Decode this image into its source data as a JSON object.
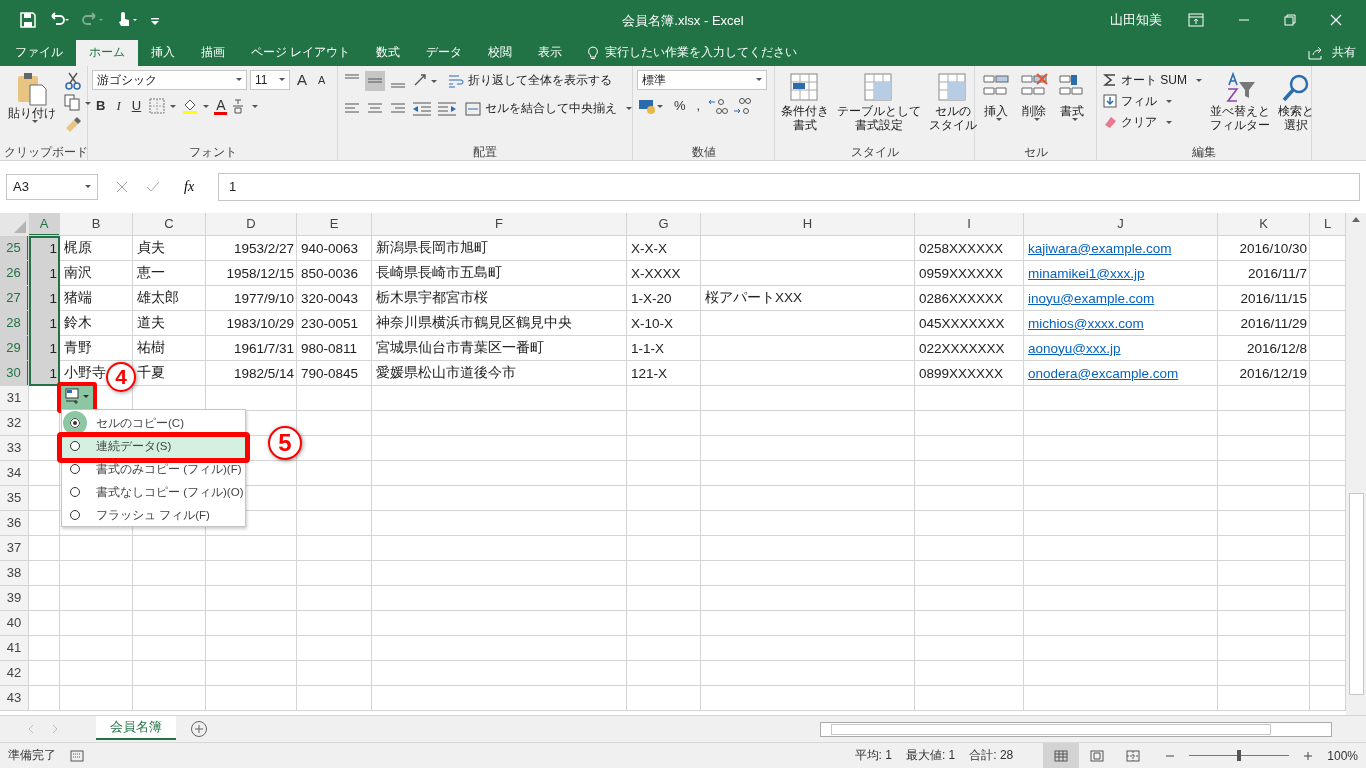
{
  "title_bar": {
    "title": "会員名簿.xlsx  -  Excel",
    "user": "山田知美"
  },
  "menu_tabs": [
    {
      "label": "ファイル",
      "selected": false
    },
    {
      "label": "ホーム",
      "selected": true
    },
    {
      "label": "挿入",
      "selected": false
    },
    {
      "label": "描画",
      "selected": false
    },
    {
      "label": "ページ レイアウト",
      "selected": false
    },
    {
      "label": "数式",
      "selected": false
    },
    {
      "label": "データ",
      "selected": false
    },
    {
      "label": "校閲",
      "selected": false
    },
    {
      "label": "表示",
      "selected": false
    }
  ],
  "tell_me": "実行したい作業を入力してください",
  "share": "共有",
  "ribbon": {
    "clipboard": {
      "paste": "貼り付け",
      "label": "クリップボード"
    },
    "font": {
      "name": "游ゴシック",
      "size": "11",
      "grow": "A",
      "shrink": "A",
      "styles": [
        "B",
        "I",
        "U"
      ],
      "color_letter": "A",
      "label": "フォント"
    },
    "alignment": {
      "wrap": "折り返して全体を表示する",
      "merge": "セルを結合して中央揃え",
      "label": "配置"
    },
    "number": {
      "format": "標準",
      "percent": "%",
      "comma": ",",
      "label": "数値"
    },
    "styles": {
      "label": "スタイル",
      "buttons": [
        {
          "lines": [
            "条件付き",
            "書式"
          ]
        },
        {
          "lines": [
            "テーブルとして",
            "書式設定"
          ]
        },
        {
          "lines": [
            "セルの",
            "スタイル"
          ]
        }
      ]
    },
    "cells": {
      "label": "セル",
      "buttons": [
        {
          "lines": [
            "挿入"
          ]
        },
        {
          "lines": [
            "削除"
          ]
        },
        {
          "lines": [
            "書式"
          ]
        }
      ]
    },
    "editing": {
      "label": "編集",
      "autosum": "オート SUM",
      "fill": "フィル",
      "clear": "クリア",
      "buttons": [
        {
          "lines": [
            "並べ替えと",
            "フィルター"
          ]
        },
        {
          "lines": [
            "検索と",
            "選択"
          ]
        }
      ]
    }
  },
  "formula_bar": {
    "name_box": "A3",
    "function_label": "fx",
    "formula": "1"
  },
  "sheet": {
    "columns": [
      {
        "letter": "A",
        "kind": "number",
        "selected": true
      },
      {
        "letter": "B",
        "kind": "text",
        "selected": false
      },
      {
        "letter": "C",
        "kind": "text",
        "selected": false
      },
      {
        "letter": "D",
        "kind": "date",
        "selected": false
      },
      {
        "letter": "E",
        "kind": "text",
        "selected": false
      },
      {
        "letter": "F",
        "kind": "text",
        "selected": false
      },
      {
        "letter": "G",
        "kind": "text",
        "selected": false
      },
      {
        "letter": "H",
        "kind": "text",
        "selected": false
      },
      {
        "letter": "I",
        "kind": "text",
        "selected": false
      },
      {
        "letter": "J",
        "kind": "link",
        "selected": false
      },
      {
        "letter": "K",
        "kind": "date",
        "selected": false
      },
      {
        "letter": "L",
        "selected": false
      }
    ],
    "rows": [
      {
        "number": "25",
        "selected": true,
        "cells": [
          "1",
          "梶原",
          "貞夫",
          "1953/2/27",
          "940-0063",
          "新潟県長岡市旭町",
          "X-X-X",
          "",
          "0258XXXXXX",
          "kajiwara@example.com",
          "2016/10/30",
          ""
        ]
      },
      {
        "number": "26",
        "selected": true,
        "cells": [
          "1",
          "南沢",
          "恵一",
          "1958/12/15",
          "850-0036",
          "長崎県長崎市五島町",
          "X-XXXX",
          "",
          "0959XXXXXX",
          "minamikei1@xxx.jp",
          "2016/11/7",
          ""
        ]
      },
      {
        "number": "27",
        "selected": true,
        "cells": [
          "1",
          "猪端",
          "雄太郎",
          "1977/9/10",
          "320-0043",
          "栃木県宇都宮市桜",
          "1-X-20",
          "桜アパートXXX",
          "0286XXXXXX",
          "inoyu@example.com",
          "2016/11/15",
          ""
        ]
      },
      {
        "number": "28",
        "selected": true,
        "cells": [
          "1",
          "鈴木",
          "道夫",
          "1983/10/29",
          "230-0051",
          "神奈川県横浜市鶴見区鶴見中央",
          "X-10-X",
          "",
          "045XXXXXXX",
          "michios@xxxx.com",
          "2016/11/29",
          ""
        ]
      },
      {
        "number": "29",
        "selected": true,
        "cells": [
          "1",
          "青野",
          "祐樹",
          "1961/7/31",
          "980-0811",
          "宮城県仙台市青葉区一番町",
          "1-1-X",
          "",
          "022XXXXXXX",
          "aonoyu@xxx.jp",
          "2016/12/8",
          ""
        ]
      },
      {
        "number": "30",
        "selected": true,
        "cells": [
          "1",
          "小野寺",
          "千夏",
          "1982/5/14",
          "790-0845",
          "愛媛県松山市道後今市",
          "121-X",
          "",
          "0899XXXXXX",
          "onodera@excample.com",
          "2016/12/19",
          ""
        ]
      },
      {
        "number": "31",
        "selected": false,
        "cells": []
      },
      {
        "number": "32",
        "selected": false,
        "cells": []
      },
      {
        "number": "33",
        "selected": false,
        "cells": []
      },
      {
        "number": "34",
        "selected": false,
        "cells": []
      },
      {
        "number": "35",
        "selected": false,
        "cells": []
      },
      {
        "number": "36",
        "selected": false,
        "cells": []
      },
      {
        "number": "37",
        "selected": false,
        "cells": []
      },
      {
        "number": "38",
        "selected": false,
        "cells": []
      },
      {
        "number": "39",
        "selected": false,
        "cells": []
      },
      {
        "number": "40",
        "selected": false,
        "cells": []
      },
      {
        "number": "41",
        "selected": false,
        "cells": []
      },
      {
        "number": "42",
        "selected": false,
        "cells": []
      },
      {
        "number": "43",
        "selected": false,
        "cells": []
      }
    ]
  },
  "fill_menu": {
    "items": [
      {
        "label": "セルのコピー(C)",
        "selected": true,
        "highlighted": false
      },
      {
        "label": "連続データ(S)",
        "selected": false,
        "highlighted": true
      },
      {
        "label": "書式のみコピー (フィル)(F)",
        "selected": false,
        "highlighted": false
      },
      {
        "label": "書式なしコピー (フィル)(O)",
        "selected": false,
        "highlighted": false
      },
      {
        "label": "フラッシュ フィル(F)",
        "selected": false,
        "highlighted": false
      }
    ]
  },
  "callouts": [
    {
      "number": "4"
    },
    {
      "number": "5"
    }
  ],
  "sheet_tabs": [
    {
      "label": "会員名簿",
      "selected": true
    }
  ],
  "status_bar": {
    "ready": "準備完了",
    "average": "平均: 1",
    "max": "最大値: 1",
    "sum": "合計: 28",
    "views": [
      {
        "kind": "normal",
        "selected": true
      },
      {
        "kind": "layout",
        "selected": false
      },
      {
        "kind": "break",
        "selected": false
      }
    ],
    "zoom": {
      "level": 0.5,
      "percent": "100%"
    }
  }
}
